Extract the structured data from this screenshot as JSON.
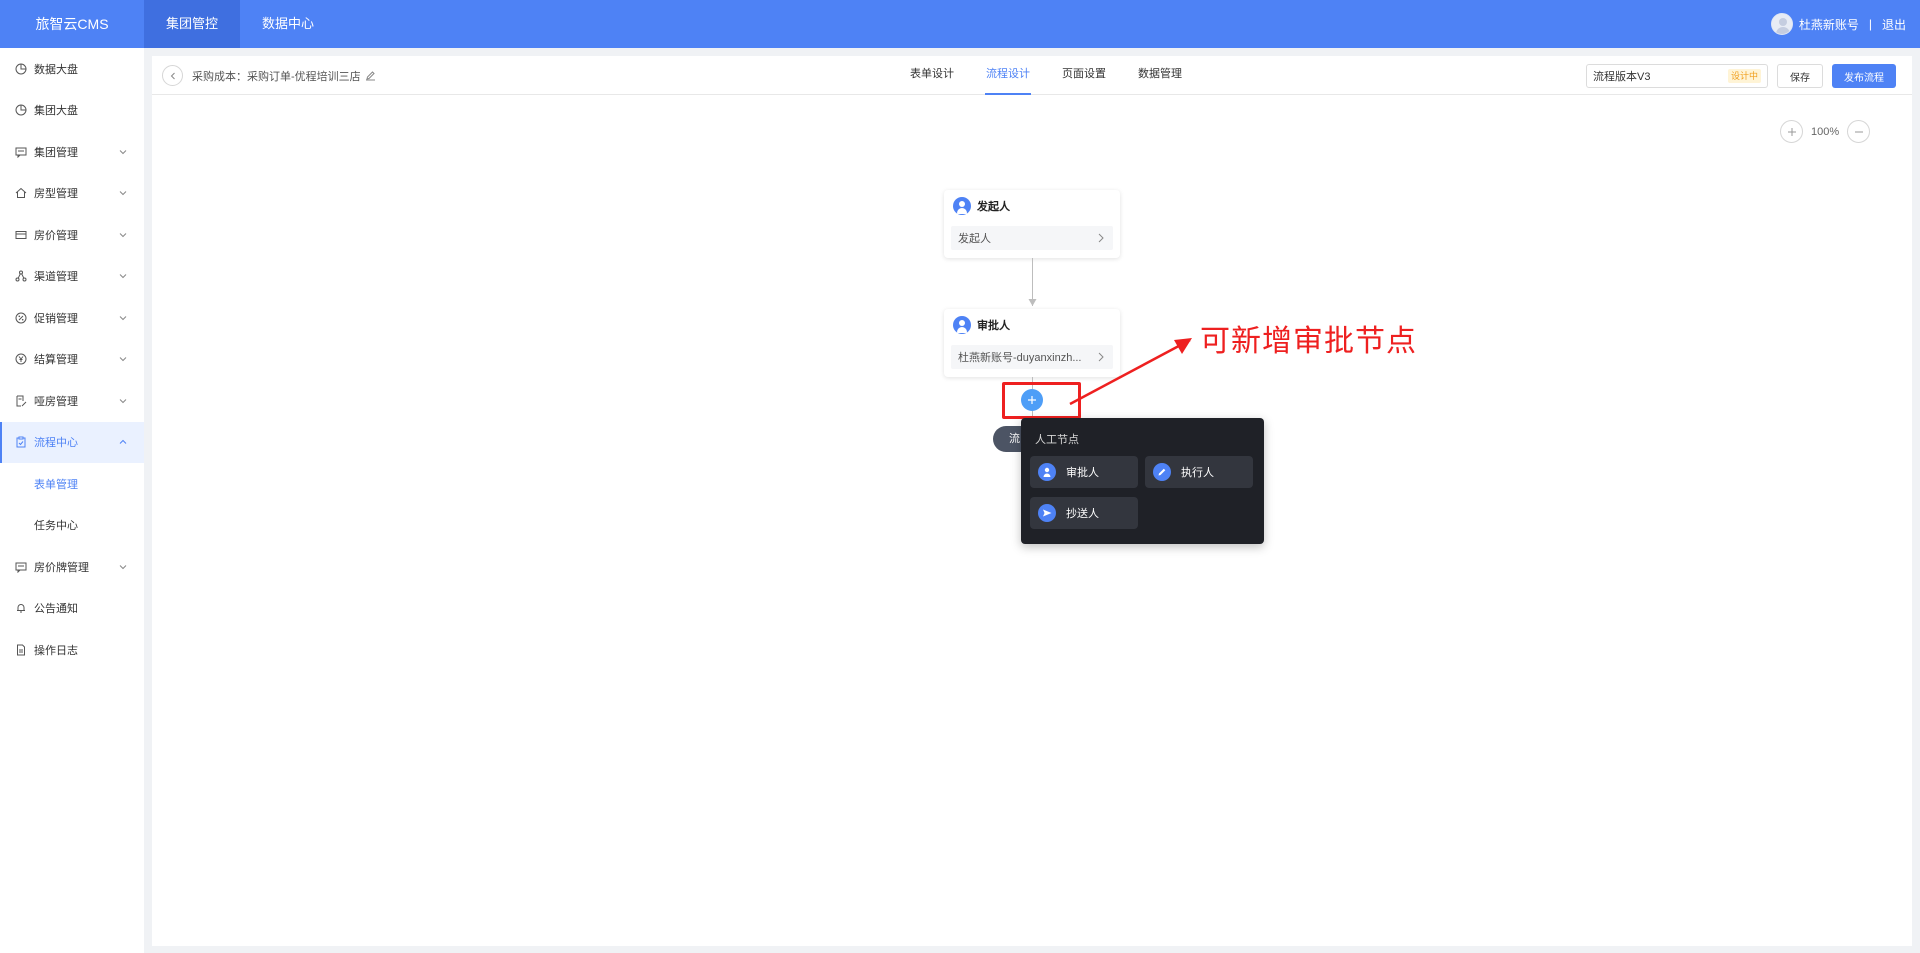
{
  "topbar": {
    "brand": "旅智云CMS",
    "nav": [
      {
        "label": "集团管控",
        "active": true
      },
      {
        "label": "数据中心",
        "active": false
      }
    ],
    "user_name": "杜燕新账号",
    "separator": "|",
    "logout": "退出"
  },
  "sidebar": {
    "items": [
      {
        "label": "数据大盘",
        "icon": "pie-chart-icon"
      },
      {
        "label": "集团大盘",
        "icon": "pie-chart-icon"
      },
      {
        "label": "集团管理",
        "icon": "message-square-icon",
        "expandable": true
      },
      {
        "label": "房型管理",
        "icon": "home-icon",
        "expandable": true
      },
      {
        "label": "房价管理",
        "icon": "card-icon",
        "expandable": true
      },
      {
        "label": "渠道管理",
        "icon": "share-nodes-icon",
        "expandable": true
      },
      {
        "label": "促销管理",
        "icon": "percent-icon",
        "expandable": true
      },
      {
        "label": "结算管理",
        "icon": "yen-circle-icon",
        "expandable": true
      },
      {
        "label": "哑房管理",
        "icon": "document-edit-icon",
        "expandable": true
      },
      {
        "label": "流程中心",
        "icon": "clipboard-icon",
        "expandable": true,
        "expanded": true,
        "active": true
      },
      {
        "label": "房价牌管理",
        "icon": "message-square-icon",
        "expandable": true
      },
      {
        "label": "公告通知",
        "icon": "bell-icon"
      },
      {
        "label": "操作日志",
        "icon": "file-text-icon"
      }
    ],
    "sub_items": [
      {
        "label": "表单管理",
        "active": true
      },
      {
        "label": "任务中心",
        "active": false
      }
    ]
  },
  "toolbar": {
    "breadcrumb": "采购成本：采购订单-优程培训三店",
    "tabs": [
      {
        "label": "表单设计",
        "active": false
      },
      {
        "label": "流程设计",
        "active": true
      },
      {
        "label": "页面设置",
        "active": false
      },
      {
        "label": "数据管理",
        "active": false
      }
    ],
    "version_value": "流程版本V3",
    "version_badge": "设计中",
    "save_label": "保存",
    "publish_label": "发布流程"
  },
  "zoom": {
    "level": "100%"
  },
  "flow": {
    "initiator": {
      "title": "发起人",
      "value": "发起人"
    },
    "approver": {
      "title": "审批人",
      "value": "杜燕新账号-duyanxinzh..."
    },
    "end_label": "流"
  },
  "popover": {
    "title": "人工节点",
    "options": [
      {
        "label": "审批人",
        "icon": "user-icon"
      },
      {
        "label": "执行人",
        "icon": "pencil-icon"
      },
      {
        "label": "抄送人",
        "icon": "send-icon"
      }
    ]
  },
  "annotation": {
    "text": "可新增审批节点",
    "color": "#ee2020"
  },
  "colors": {
    "accent": "#4e82f5",
    "popover_bg": "#1f2127",
    "annotation_red": "#ee2020"
  }
}
